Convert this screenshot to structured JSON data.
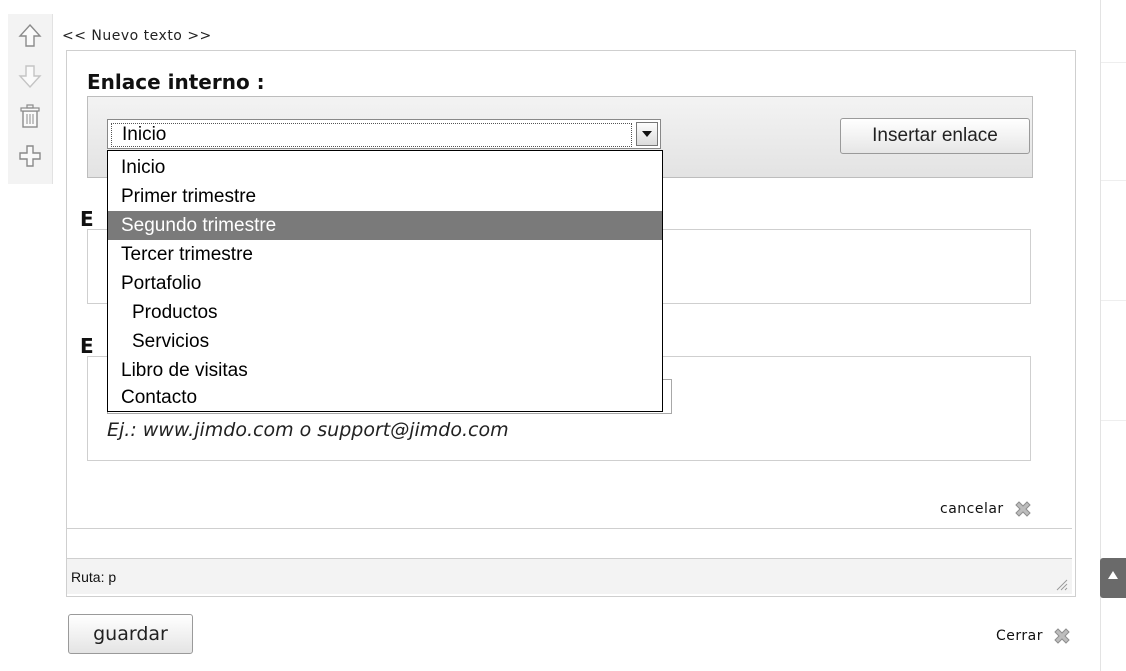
{
  "element": {
    "header": "<< Nuevo texto >>"
  },
  "toolbar": {
    "icons": [
      "arrow-up-icon",
      "arrow-down-icon",
      "trash-icon",
      "plus-icon"
    ]
  },
  "link_dialog": {
    "internal_title": "Enlace interno :",
    "selected_page": "Inicio",
    "insert_button": "Insertar enlace",
    "pages": [
      {
        "label": "Inicio",
        "level": 0
      },
      {
        "label": "Primer trimestre",
        "level": 0
      },
      {
        "label": "Segundo trimestre",
        "level": 0,
        "highlighted": true
      },
      {
        "label": "Tercer trimestre",
        "level": 0
      },
      {
        "label": "Portafolio",
        "level": 0
      },
      {
        "label": "Productos",
        "level": 1
      },
      {
        "label": "Servicios",
        "level": 1
      },
      {
        "label": "Libro de visitas",
        "level": 0
      },
      {
        "label": "Contacto",
        "level": 0
      }
    ],
    "file_title_visible": "E",
    "external_title_visible": "E",
    "external_value": "",
    "example": "Ej.: www.jimdo.com o support@jimdo.com",
    "cancel": "cancelar"
  },
  "editor": {
    "path": "Ruta: p"
  },
  "footer": {
    "save": "guardar",
    "close": "Cerrar"
  },
  "colors": {
    "highlight": "#7a7a7a",
    "border": "#cfcfcf",
    "panel": "#f3f3f3"
  }
}
